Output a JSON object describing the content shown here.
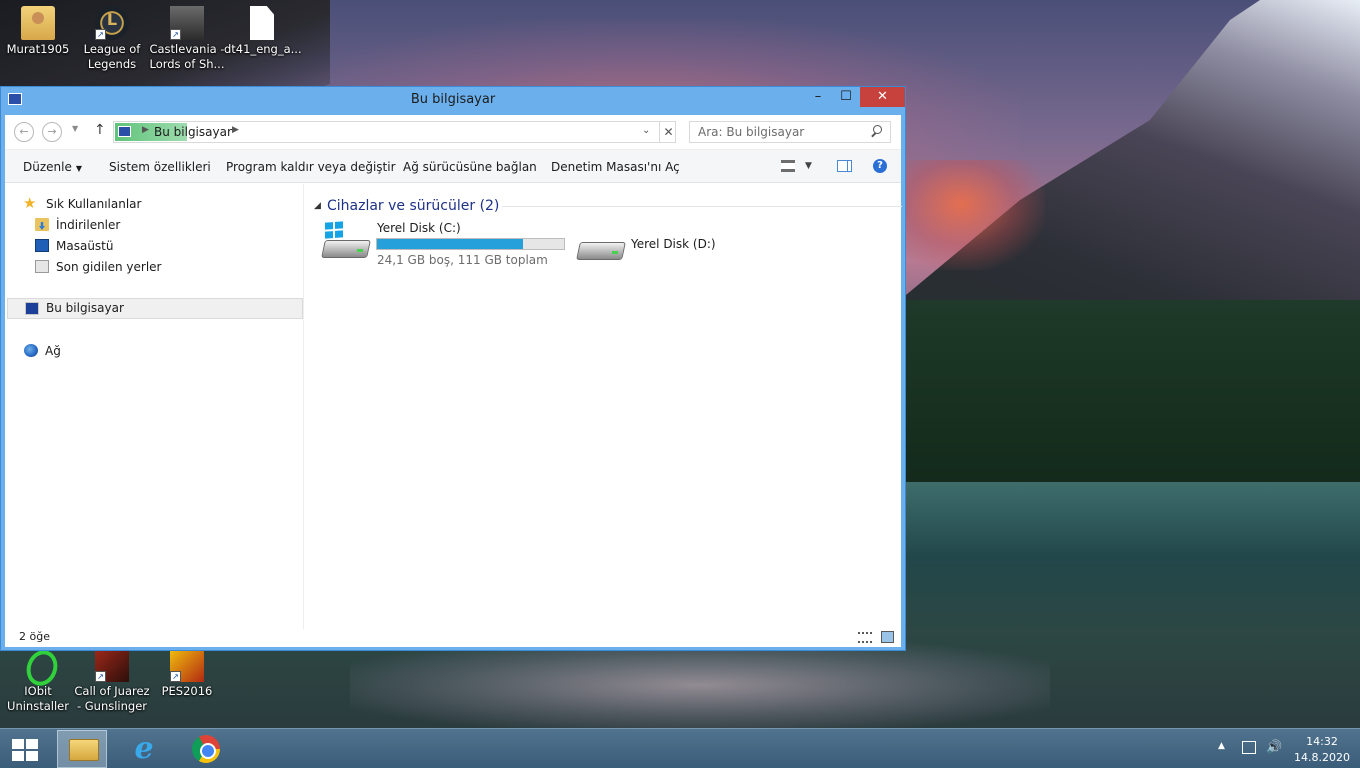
{
  "desktop": {
    "icons_top": [
      {
        "label_line1": "Murat1905",
        "label_line2": "",
        "icon": "user-folder-icon"
      },
      {
        "label_line1": "League of",
        "label_line2": "Legends",
        "icon": "league-of-legends-icon"
      },
      {
        "label_line1": "Castlevania -",
        "label_line2": "Lords of Sh...",
        "icon": "castlevania-icon"
      },
      {
        "label_line1": "dt41_eng_a...",
        "label_line2": "",
        "icon": "file-icon"
      }
    ],
    "icons_bottom": [
      {
        "label_line1": "IObit",
        "label_line2": "Uninstaller",
        "icon": "iobit-icon"
      },
      {
        "label_line1": "Call of Juarez",
        "label_line2": "- Gunslinger",
        "icon": "call-of-juarez-icon"
      },
      {
        "label_line1": "PES2016",
        "label_line2": "",
        "icon": "pes2016-icon"
      }
    ]
  },
  "window": {
    "title": "Bu bilgisayar",
    "controls": {
      "minimize": "–",
      "maximize": "☐",
      "close": "✕"
    },
    "address": {
      "location": "Bu bilgisayar"
    },
    "search": {
      "placeholder": "Ara: Bu bilgisayar"
    },
    "commands": {
      "organize": "Düzenle",
      "system_properties": "Sistem özellikleri",
      "uninstall": "Program kaldır veya değiştir",
      "map_drive": "Ağ sürücüsüne bağlan",
      "control_panel": "Denetim Masası'nı Aç"
    },
    "nav_pane": {
      "favorites": "Sık Kullanılanlar",
      "downloads": "İndirilenler",
      "desktop": "Masaüstü",
      "recent": "Son gidilen yerler",
      "this_pc": "Bu bilgisayar",
      "network": "Ağ"
    },
    "content": {
      "group_title": "Cihazlar ve sürücüler (2)",
      "drives": [
        {
          "name": "Yerel Disk (C:)",
          "info": "24,1 GB boş, 111 GB toplam",
          "used_fraction": 0.78
        },
        {
          "name": "Yerel Disk (D:)"
        }
      ]
    },
    "status": {
      "item_count": "2 öğe"
    }
  },
  "taskbar": {
    "apps": [
      "file-explorer-icon",
      "internet-explorer-icon",
      "chrome-icon"
    ],
    "clock_time": "14:32",
    "clock_date": "14.8.2020"
  },
  "colors": {
    "title_bar": "#6bb0ec",
    "close_button": "#c7413d",
    "drive_bar_fill": "#26a0da",
    "group_title": "#1e3287"
  }
}
